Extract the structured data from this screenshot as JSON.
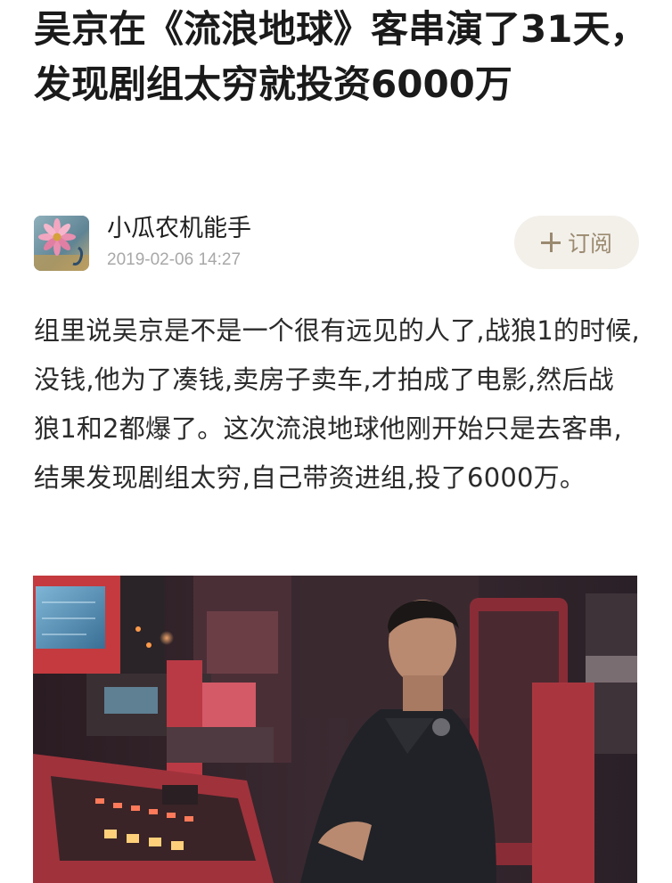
{
  "article": {
    "title": "吴京在《流浪地球》客串演了31天，发现剧组太穷就投资6000万",
    "author": {
      "name": "小瓜农机能手",
      "time": "2019-02-06 14:27"
    },
    "subscribe_label": "订阅",
    "body": "组里说吴京是不是一个很有远见的人了,战狼1的时候,没钱,他为了凑钱,卖房子卖车,才拍成了电影,然后战狼1和2都爆了。这次流浪地球他刚开始只是去客串,结果发现剧组太穷,自己带资进组,投了6000万。"
  },
  "icons": {
    "subscribe": "plus-icon",
    "avatar": "flower-photo"
  },
  "colors": {
    "subscribe_text": "#9b8a70",
    "subscribe_bg": "#f3f0ea",
    "time_text": "#a8a8a8"
  }
}
